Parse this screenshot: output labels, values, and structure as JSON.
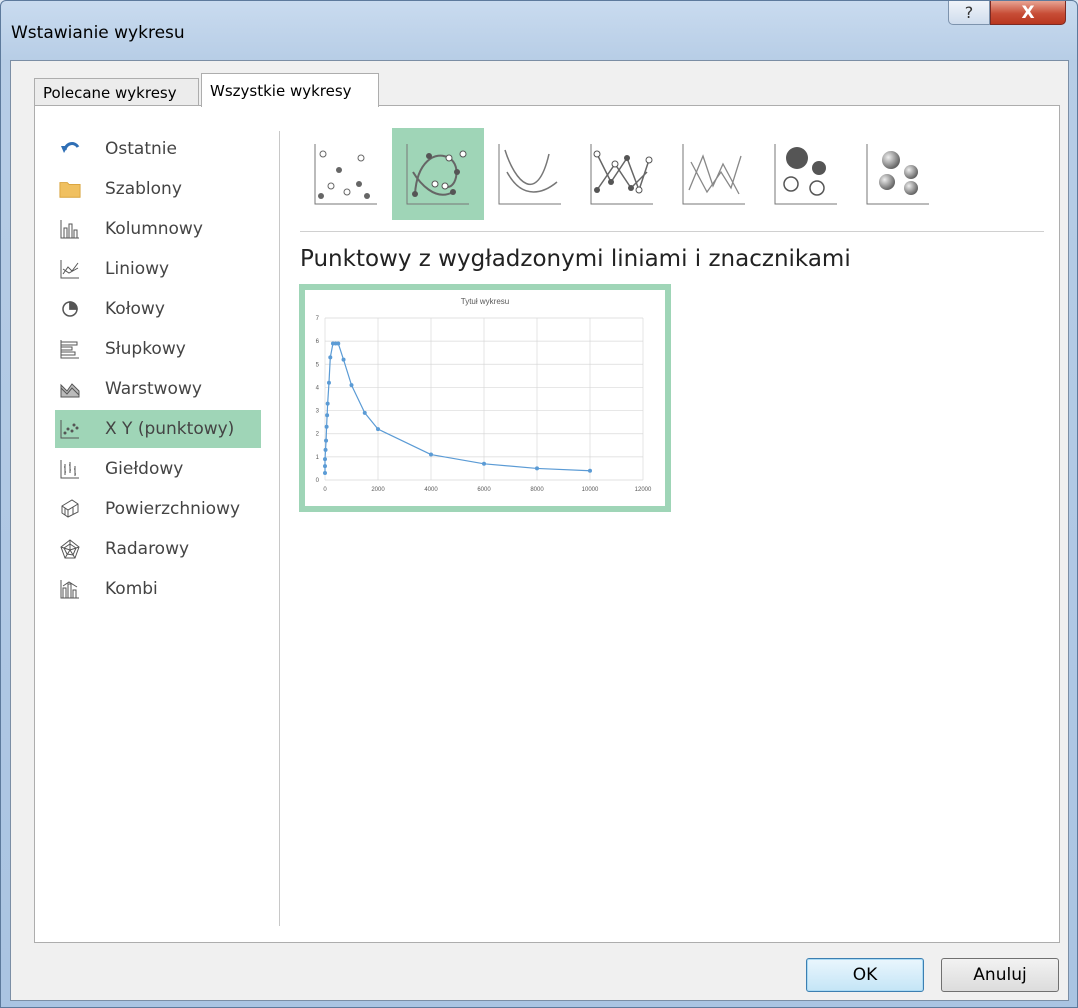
{
  "window": {
    "title": "Wstawianie wykresu",
    "help_label": "?",
    "close_label": "X"
  },
  "tabs": [
    {
      "label": "Polecane wykresy",
      "selected": false
    },
    {
      "label": "Wszystkie wykresy",
      "selected": true
    }
  ],
  "sidebar": {
    "items": [
      {
        "label": "Ostatnie",
        "icon": "undo-icon"
      },
      {
        "label": "Szablony",
        "icon": "folder-icon"
      },
      {
        "label": "Kolumnowy",
        "icon": "column-chart-icon"
      },
      {
        "label": "Liniowy",
        "icon": "line-chart-icon"
      },
      {
        "label": "Kołowy",
        "icon": "pie-chart-icon"
      },
      {
        "label": "Słupkowy",
        "icon": "bar-chart-icon"
      },
      {
        "label": "Warstwowy",
        "icon": "area-chart-icon"
      },
      {
        "label": "X Y (punktowy)",
        "icon": "scatter-chart-icon",
        "selected": true
      },
      {
        "label": "Giełdowy",
        "icon": "stock-chart-icon"
      },
      {
        "label": "Powierzchniowy",
        "icon": "surface-chart-icon"
      },
      {
        "label": "Radarowy",
        "icon": "radar-chart-icon"
      },
      {
        "label": "Kombi",
        "icon": "combo-chart-icon"
      }
    ]
  },
  "subtypes": {
    "selected_index": 1,
    "icons": [
      "scatter-icon",
      "scatter-smooth-markers-icon",
      "scatter-smooth-icon",
      "scatter-straight-markers-icon",
      "scatter-straight-icon",
      "bubble-icon",
      "bubble-3d-icon"
    ]
  },
  "selected_subtype_title": "Punktowy z wygładzonymi liniami i znacznikami",
  "chart_data": {
    "type": "scatter",
    "title": "Tytuł wykresu",
    "xlim": [
      0,
      12000
    ],
    "ylim": [
      0,
      7
    ],
    "x_ticks": [
      "0",
      "2000",
      "4000",
      "6000",
      "8000",
      "10000",
      "12000"
    ],
    "y_ticks": [
      "0",
      "1",
      "2",
      "3",
      "4",
      "5",
      "6",
      "7"
    ],
    "grid": true,
    "series": [
      {
        "x": [
          0,
          0,
          0,
          20,
          40,
          60,
          80,
          100,
          150,
          200,
          300,
          400,
          500,
          700,
          1000,
          1500,
          2000,
          4000,
          6000,
          8000,
          10000
        ],
        "y": [
          0.3,
          0.6,
          0.9,
          1.3,
          1.7,
          2.3,
          2.8,
          3.3,
          4.2,
          5.3,
          5.9,
          5.9,
          5.9,
          5.2,
          4.1,
          2.9,
          2.2,
          1.1,
          0.7,
          0.5,
          0.4
        ]
      }
    ],
    "line_color": "#5b9bd5"
  },
  "buttons": {
    "ok_label": "OK",
    "cancel_label": "Anuluj"
  },
  "colors": {
    "selection": "#9fd5b7",
    "accent_blue": "#4472c4"
  }
}
